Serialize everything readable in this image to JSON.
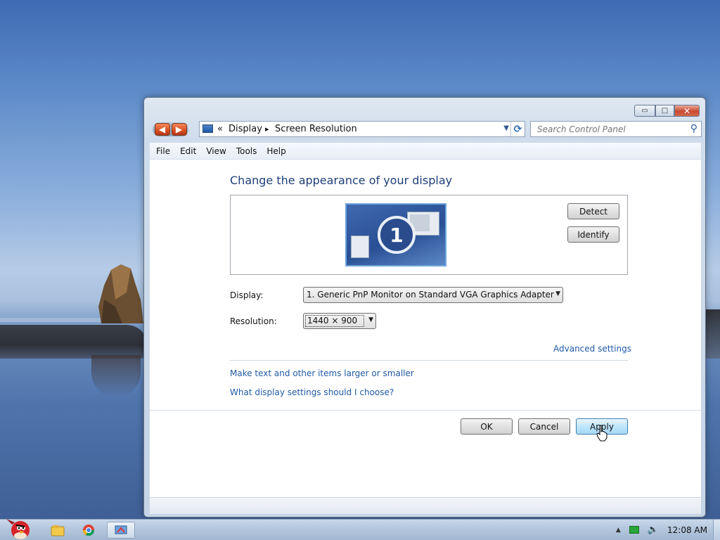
{
  "window": {
    "caption_minimize": "▭",
    "caption_maximize": "□",
    "caption_close": "✕"
  },
  "address": {
    "chevron": "«",
    "crumb1": "Display",
    "arrow": "▸",
    "crumb2": "Screen Resolution"
  },
  "search": {
    "placeholder": "Search Control Panel"
  },
  "menu": {
    "file": "File",
    "edit": "Edit",
    "view": "View",
    "tools": "Tools",
    "help": "Help"
  },
  "main": {
    "title": "Change the appearance of your display",
    "monitor_number": "1",
    "detect": "Detect",
    "identify": "Identify",
    "display_label": "Display:",
    "display_value": "1. Generic PnP Monitor on Standard VGA Graphics Adapter",
    "resolution_label": "Resolution:",
    "resolution_value": "1440 × 900",
    "advanced": "Advanced settings",
    "link_text_size": "Make text and other items larger or smaller",
    "link_which": "What display settings should I choose?"
  },
  "footer": {
    "ok": "OK",
    "cancel": "Cancel",
    "apply": "Apply"
  },
  "taskbar": {
    "time": "12:08 AM"
  },
  "colors": {
    "accent_link": "#1f5aa6",
    "title_blue": "#1e3f78",
    "close_red": "#c94a32"
  }
}
